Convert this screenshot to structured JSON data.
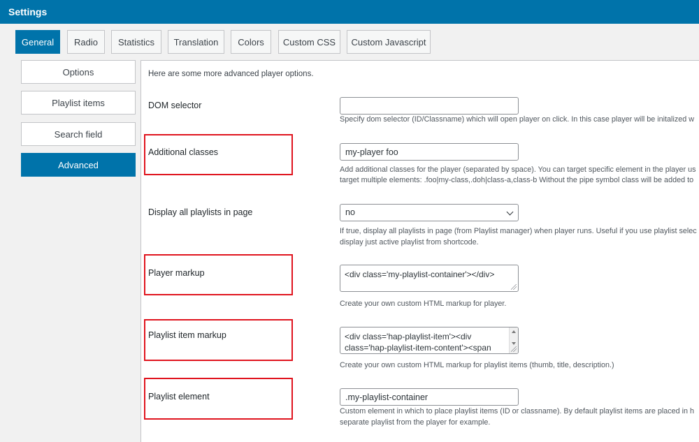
{
  "header": {
    "title": "Settings"
  },
  "tabs": [
    {
      "label": "General"
    },
    {
      "label": "Radio"
    },
    {
      "label": "Statistics"
    },
    {
      "label": "Translation"
    },
    {
      "label": "Colors"
    },
    {
      "label": "Custom CSS"
    },
    {
      "label": "Custom Javascript"
    }
  ],
  "sidebar": {
    "items": [
      {
        "label": "Options"
      },
      {
        "label": "Playlist items"
      },
      {
        "label": "Search field"
      },
      {
        "label": "Advanced"
      }
    ]
  },
  "main": {
    "intro": "Here are some more advanced player options.",
    "dom_selector": {
      "label": "DOM selector",
      "value": "",
      "desc": "Specify dom selector (ID/Classname) which will open player on click. In this case player will be initalized w"
    },
    "additional_classes": {
      "label": "Additional classes",
      "value": "my-player foo",
      "desc1": "Add additional classes for the player (separated by space). You can target specific element in the player us",
      "desc2": "target multiple elements: .foo|my-class,.doh|class-a,class-b Without the pipe symbol class will be added to"
    },
    "display_all_playlists": {
      "label": "Display all playlists in page",
      "value": "no",
      "desc1": "If true, display all playlists in page (from Playlist manager) when player runs. Useful if you use playlist selec",
      "desc2": "display just active playlist from shortcode."
    },
    "player_markup": {
      "label": "Player markup",
      "value": "<div class='my-playlist-container'></div>",
      "desc": "Create your own custom HTML markup for player."
    },
    "playlist_item_markup": {
      "label": "Playlist item markup",
      "line1": "<div class='hap-playlist-item'><div",
      "line2": "class='hap-playlist-item-content'><span",
      "desc": "Create your own custom HTML markup for playlist items (thumb, title, description.)"
    },
    "playlist_element": {
      "label": "Playlist element",
      "value": ".my-playlist-container",
      "desc1": "Custom element in which to place playlist items (ID or classname). By default playlist items are placed in h",
      "desc2": "separate playlist from the player for example."
    }
  },
  "colors": {
    "accent": "#0073aa",
    "highlight": "#e0141e"
  }
}
